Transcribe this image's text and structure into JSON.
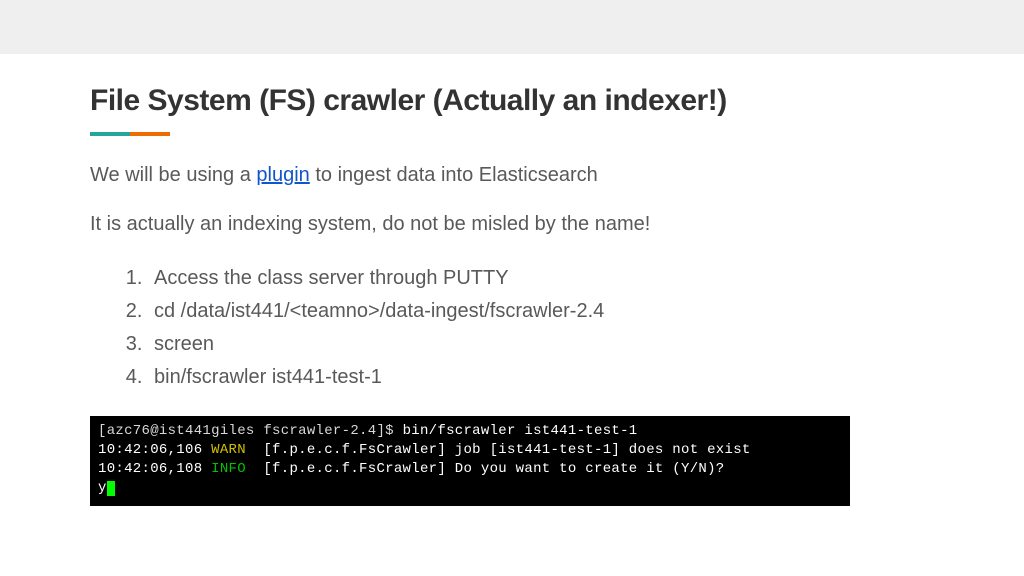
{
  "title": "File System (FS) crawler (Actually an indexer!)",
  "para1_prefix": "We will be using a ",
  "para1_link": "plugin",
  "para1_suffix": " to ingest data into Elasticsearch",
  "para2": "It is actually an indexing system, do not be misled by the name!",
  "steps": {
    "s1": "Access the class server through PUTTY",
    "s2": "cd /data/ist441/<teamno>/data-ingest/fscrawler-2.4",
    "s3": "screen",
    "s4": " bin/fscrawler ist441-test-1"
  },
  "terminal": {
    "l1_prompt": "[azc76@ist441giles fscrawler-2.4]$ ",
    "l1_cmd": "bin/fscrawler ist441-test-1",
    "l2_time": "10:42:06,106 ",
    "l2_level": "WARN",
    "l2_rest": "  [f.p.e.c.f.FsCrawler] job [ist441-test-1] does not exist",
    "l3_time": "10:42:06,108 ",
    "l3_level": "INFO",
    "l3_rest": "  [f.p.e.c.f.FsCrawler] Do you want to create it (Y/N)?",
    "l4_input": "y"
  }
}
